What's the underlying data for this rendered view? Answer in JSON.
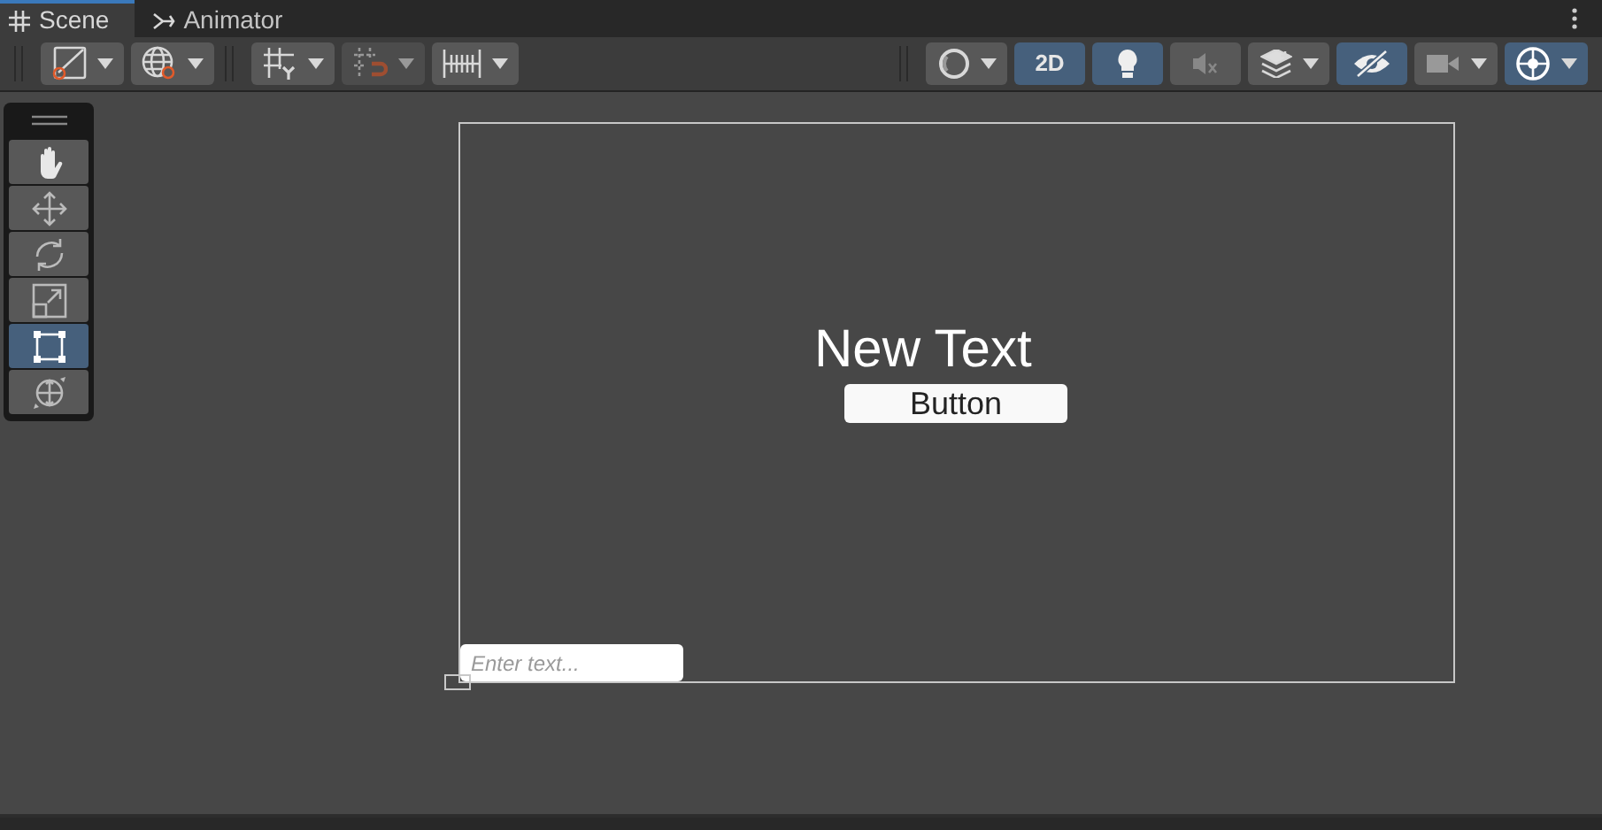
{
  "tabs": [
    {
      "label": "Scene",
      "selected": true
    },
    {
      "label": "Animator",
      "selected": false
    }
  ],
  "toolbar_left": [
    {
      "on": false,
      "dropdown": true,
      "disabled": false
    },
    {
      "on": false,
      "dropdown": true,
      "disabled": false
    },
    {
      "on": false,
      "dropdown": true,
      "disabled": false
    },
    {
      "on": false,
      "dropdown": true,
      "disabled": true
    },
    {
      "on": false,
      "dropdown": true,
      "disabled": false
    }
  ],
  "toolbar_right": [
    {
      "on": false,
      "dropdown": true
    },
    {
      "label": "2D",
      "on": true,
      "dropdown": false
    },
    {
      "on": true,
      "dropdown": false
    },
    {
      "on": false,
      "dropdown": false
    },
    {
      "on": false,
      "dropdown": true
    },
    {
      "on": true,
      "dropdown": false
    },
    {
      "on": false,
      "dropdown": true
    },
    {
      "on": true,
      "dropdown": true
    }
  ],
  "tools": [
    {
      "selected": false
    },
    {
      "selected": false
    },
    {
      "selected": false
    },
    {
      "selected": false
    },
    {
      "selected": true
    },
    {
      "selected": false
    }
  ],
  "scene": {
    "text": "New Text",
    "button": "Button",
    "input_placeholder": "Enter text..."
  }
}
